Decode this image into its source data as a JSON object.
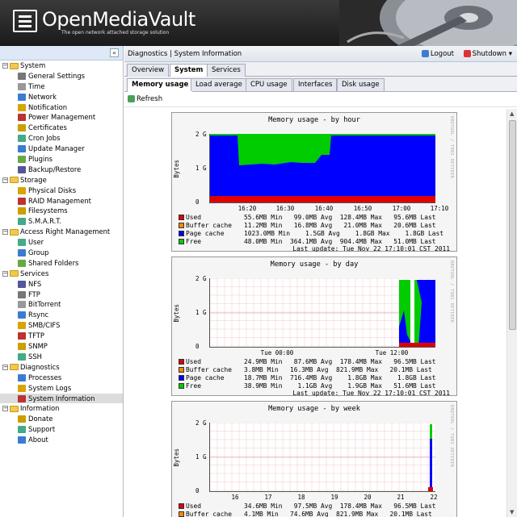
{
  "header": {
    "title": "OpenMediaVault",
    "subtitle": "The open network attached storage solution"
  },
  "nav": {
    "collapse_label": "«",
    "groups": [
      {
        "label": "System",
        "items": [
          "General Settings",
          "Time",
          "Network",
          "Notification",
          "Power Management",
          "Certificates",
          "Cron Jobs",
          "Update Manager",
          "Plugins",
          "Backup/Restore"
        ]
      },
      {
        "label": "Storage",
        "items": [
          "Physical Disks",
          "RAID Management",
          "Filesystems",
          "S.M.A.R.T."
        ]
      },
      {
        "label": "Access Right Management",
        "items": [
          "User",
          "Group",
          "Shared Folders"
        ]
      },
      {
        "label": "Services",
        "items": [
          "NFS",
          "FTP",
          "BitTorrent",
          "Rsync",
          "SMB/CIFS",
          "TFTP",
          "SNMP",
          "SSH"
        ]
      },
      {
        "label": "Diagnostics",
        "items": [
          "Processes",
          "System Logs",
          "System Information"
        ]
      },
      {
        "label": "Information",
        "items": [
          "Donate",
          "Support",
          "About"
        ]
      }
    ],
    "selected": "System Information"
  },
  "main": {
    "breadcrumb": "Diagnostics | System Information",
    "logout": "Logout",
    "shutdown": "Shutdown",
    "tabs": [
      "Overview",
      "System",
      "Services"
    ],
    "active_tab": "System",
    "subtabs": [
      "Memory usage",
      "Load average",
      "CPU usage",
      "Interfaces",
      "Disk usage"
    ],
    "active_subtab": "Memory usage",
    "refresh": "Refresh"
  },
  "colors": {
    "used": "#e00000",
    "buffer": "#ff8800",
    "page_cache": "#0000ff",
    "free": "#00cc00"
  },
  "graphs": [
    {
      "title": "Memory usage - by hour",
      "ylabel": "Bytes",
      "yticks": [
        "2 G",
        "1 G",
        "0"
      ],
      "xticks": [
        "16:20",
        "16:30",
        "16:40",
        "16:50",
        "17:00",
        "17:10"
      ],
      "rrd_label": "RRDTOOL / TOBI OETIKER",
      "legend": [
        {
          "name": "Used",
          "text": "55.6MB Min   99.0MB Avg  128.4MB Max   95.6MB Last"
        },
        {
          "name": "Buffer cache",
          "text": "11.2MB Min   16.8MB Avg   21.0MB Max   20.6MB Last"
        },
        {
          "name": "Page cache",
          "text": "1023.0MB Min    1.5GB Avg    1.8GB Max    1.8GB Last"
        },
        {
          "name": "Free",
          "text": "48.0MB Min  364.1MB Avg  904.4MB Max   51.0MB Last"
        }
      ],
      "last_update": "Last update: Tue Nov 22 17:10:01 CST 2011"
    },
    {
      "title": "Memory usage - by day",
      "ylabel": "Bytes",
      "yticks": [
        "2 G",
        "1 G",
        "0"
      ],
      "xticks": [
        "Tue 00:00",
        "Tue 12:00"
      ],
      "rrd_label": "RRDTOOL / TOBI OETIKER",
      "legend": [
        {
          "name": "Used",
          "text": "24.9MB Min   87.6MB Avg  178.4MB Max   96.5MB Last"
        },
        {
          "name": "Buffer cache",
          "text": "3.8MB Min   16.3MB Avg  821.9MB Max   20.1MB Last"
        },
        {
          "name": "Page cache",
          "text": "18.7MB Min  716.4MB Avg    1.8GB Max    1.8GB Last"
        },
        {
          "name": "Free",
          "text": "38.9MB Min    1.1GB Avg    1.9GB Max   51.6MB Last"
        }
      ],
      "last_update": "Last update: Tue Nov 22 17:10:01 CST 2011"
    },
    {
      "title": "Memory usage - by week",
      "ylabel": "Bytes",
      "yticks": [
        "2 G",
        "1 G",
        "0"
      ],
      "xticks": [
        "16",
        "17",
        "18",
        "19",
        "20",
        "21",
        "22"
      ],
      "rrd_label": "RRDTOOL / TOBI OETIKER",
      "legend": [
        {
          "name": "Used",
          "text": "34.6MB Min   97.5MB Avg  178.4MB Max   96.5MB Last"
        },
        {
          "name": "Buffer cache",
          "text": "4.1MB Min   74.6MB Avg  821.9MB Max   20.1MB Last"
        }
      ],
      "last_update": ""
    }
  ]
}
